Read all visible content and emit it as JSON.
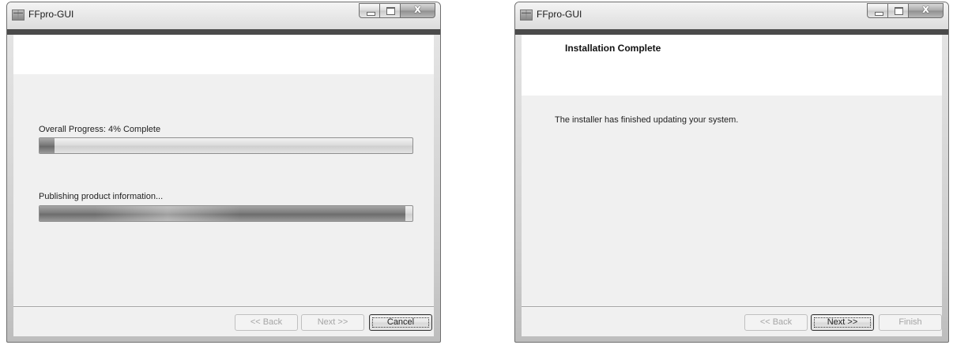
{
  "windows": [
    {
      "title": "FFpro-GUI",
      "header_title": "",
      "progress": {
        "overall_label": "Overall Progress: 4% Complete",
        "overall_percent": 4,
        "status_label": "Publishing product information...",
        "status_percent": 98
      },
      "buttons": {
        "back": "<< Back",
        "next": "Next >>",
        "cancel": "Cancel"
      }
    },
    {
      "title": "FFpro-GUI",
      "header_title": "Installation Complete",
      "body_text": "The installer has finished updating your system.",
      "buttons": {
        "back": "<< Back",
        "next": "Next >>",
        "finish": "Finish"
      }
    }
  ],
  "icons": {
    "app": "installer-app-icon",
    "minimize": "minimize-icon",
    "maximize": "maximize-icon",
    "close": "close-icon"
  },
  "close_glyph": "x"
}
